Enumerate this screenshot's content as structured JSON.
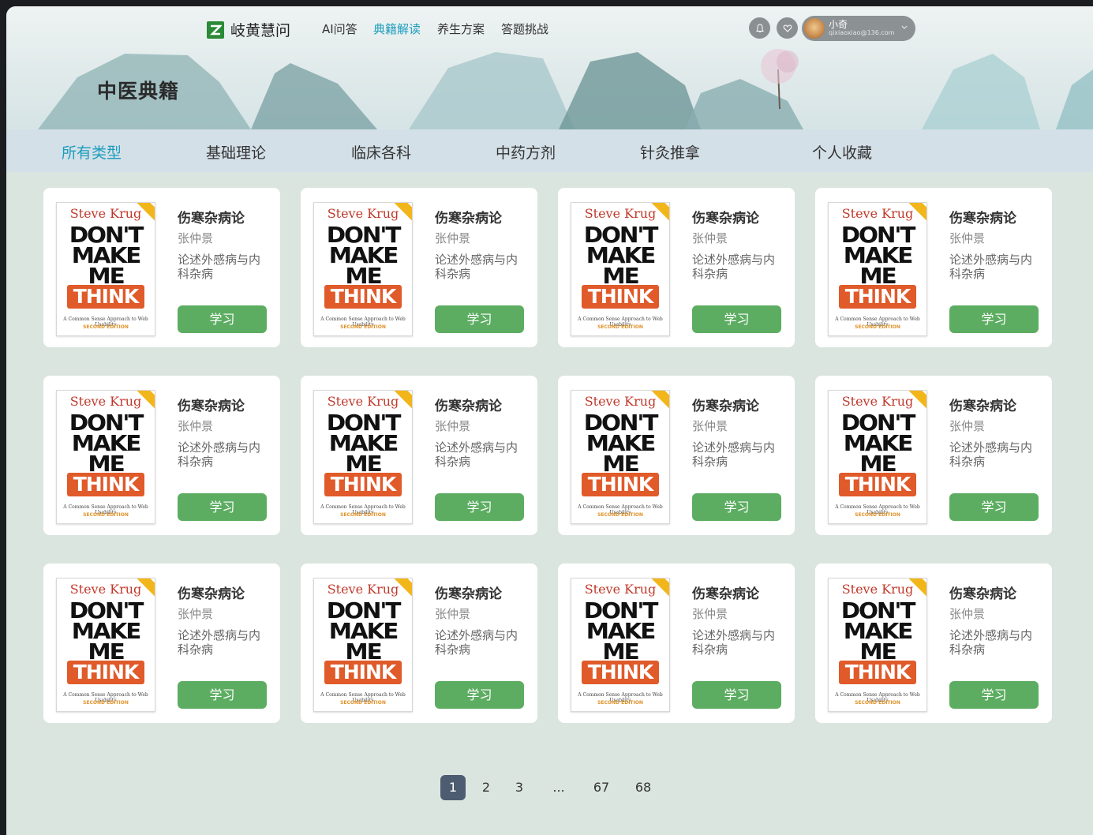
{
  "app": {
    "name": "岐黄慧问"
  },
  "nav": {
    "items": [
      {
        "label": "AI问答",
        "active": false
      },
      {
        "label": "典籍解读",
        "active": true
      },
      {
        "label": "养生方案",
        "active": false
      },
      {
        "label": "答题挑战",
        "active": false
      }
    ],
    "icons": [
      "bell-icon",
      "heart-icon"
    ]
  },
  "user": {
    "name": "小奇",
    "email": "qixiaoxiao@136.com"
  },
  "page": {
    "title": "中医典籍"
  },
  "tabs": [
    {
      "label": "所有类型",
      "active": true
    },
    {
      "label": "基础理论",
      "active": false
    },
    {
      "label": "临床各科",
      "active": false
    },
    {
      "label": "中药方剂",
      "active": false
    },
    {
      "label": "针灸推拿",
      "active": false
    },
    {
      "label": "个人收藏",
      "active": false
    }
  ],
  "cover": {
    "author": "Steve Krug",
    "line1": "DON'T",
    "line2": "MAKE",
    "line3": "ME",
    "line4": "THINK",
    "subtitle": "A Common Sense Approach to Web Usability",
    "edition": "SECOND EDITION"
  },
  "books": [
    {
      "title": "伤寒杂病论",
      "author": "张仲景",
      "desc": "论述外感病与内科杂病",
      "button": "学习"
    },
    {
      "title": "伤寒杂病论",
      "author": "张仲景",
      "desc": "论述外感病与内科杂病",
      "button": "学习"
    },
    {
      "title": "伤寒杂病论",
      "author": "张仲景",
      "desc": "论述外感病与内科杂病",
      "button": "学习"
    },
    {
      "title": "伤寒杂病论",
      "author": "张仲景",
      "desc": "论述外感病与内科杂病",
      "button": "学习"
    },
    {
      "title": "伤寒杂病论",
      "author": "张仲景",
      "desc": "论述外感病与内科杂病",
      "button": "学习"
    },
    {
      "title": "伤寒杂病论",
      "author": "张仲景",
      "desc": "论述外感病与内科杂病",
      "button": "学习"
    },
    {
      "title": "伤寒杂病论",
      "author": "张仲景",
      "desc": "论述外感病与内科杂病",
      "button": "学习"
    },
    {
      "title": "伤寒杂病论",
      "author": "张仲景",
      "desc": "论述外感病与内科杂病",
      "button": "学习"
    },
    {
      "title": "伤寒杂病论",
      "author": "张仲景",
      "desc": "论述外感病与内科杂病",
      "button": "学习"
    },
    {
      "title": "伤寒杂病论",
      "author": "张仲景",
      "desc": "论述外感病与内科杂病",
      "button": "学习"
    },
    {
      "title": "伤寒杂病论",
      "author": "张仲景",
      "desc": "论述外感病与内科杂病",
      "button": "学习"
    },
    {
      "title": "伤寒杂病论",
      "author": "张仲景",
      "desc": "论述外感病与内科杂病",
      "button": "学习"
    }
  ],
  "pagination": {
    "pages": [
      {
        "label": "1",
        "active": true
      },
      {
        "label": "2",
        "active": false
      },
      {
        "label": "3",
        "active": false
      },
      {
        "label": "...",
        "active": false
      },
      {
        "label": "67",
        "active": false
      },
      {
        "label": "68",
        "active": false
      }
    ]
  },
  "colors": {
    "accent": "#1b9dbd",
    "button": "#5cad61",
    "pager_active": "#4d5c70",
    "background": "#dbe5e0"
  }
}
